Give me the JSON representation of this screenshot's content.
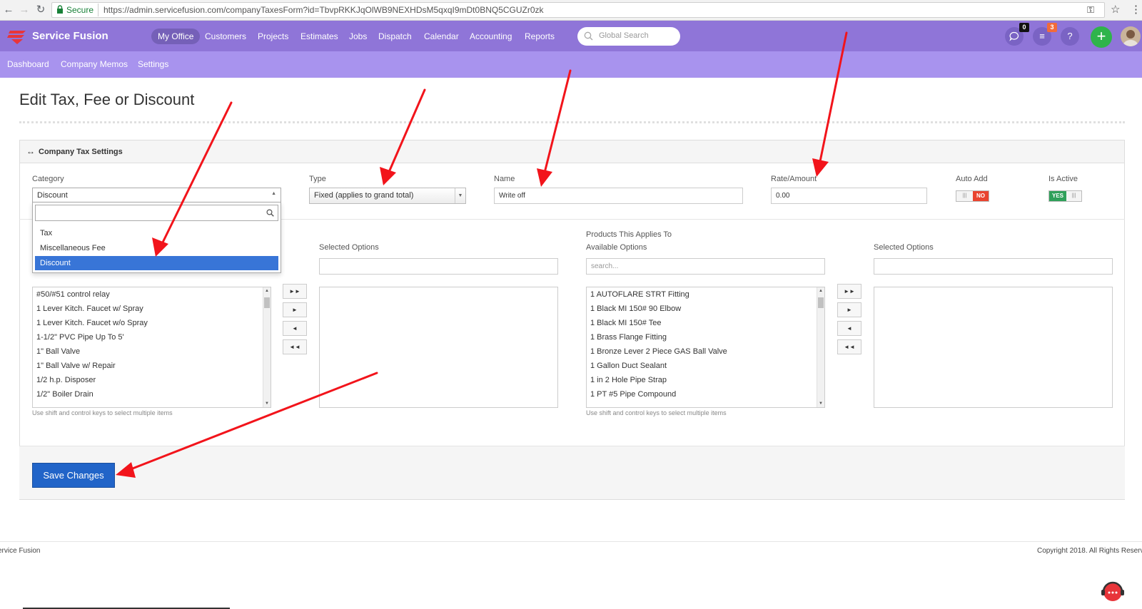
{
  "browser": {
    "secure_label": "Secure",
    "url": "https://admin.servicefusion.com/companyTaxesForm?id=TbvpRKKJqOlWB9NEXHDsM5qxqI9mDt0BNQ5CGUZr0zk"
  },
  "header": {
    "brand": "Service Fusion",
    "nav": [
      "My Office",
      "Customers",
      "Projects",
      "Estimates",
      "Jobs",
      "Dispatch",
      "Calendar",
      "Accounting",
      "Reports"
    ],
    "active_nav": "My Office",
    "search_placeholder": "Global Search",
    "chat_count": "0",
    "tasks_count": "3",
    "help_label": "?",
    "add_label": "+",
    "brand_color": "#8f75d8"
  },
  "subnav": [
    "Dashboard",
    "Company Memos",
    "Settings"
  ],
  "page": {
    "title": "Edit Tax, Fee or Discount",
    "panel_title": "Company Tax Settings"
  },
  "form": {
    "category_label": "Category",
    "category_value": "Discount",
    "category_options": [
      "Tax",
      "Miscellaneous Fee",
      "Discount"
    ],
    "category_selected": "Discount",
    "type_label": "Type",
    "type_value": "Fixed (applies to grand total)",
    "name_label": "Name",
    "name_value": "Write off",
    "rate_label": "Rate/Amount",
    "rate_value": "0.00",
    "auto_add_label": "Auto Add",
    "auto_add_state": "NO",
    "is_active_label": "Is Active",
    "is_active_state": "YES"
  },
  "services": {
    "selected_label": "Selected Options",
    "items": [
      "#50/#51 control relay",
      "1 Lever Kitch. Faucet w/ Spray",
      "1 Lever Kitch. Faucet w/o Spray",
      "1-1/2\" PVC Pipe Up To 5'",
      "1\" Ball Valve",
      "1\" Ball Valve w/ Repair",
      "1/2 h.p. Disposer",
      "1/2\" Boiler Drain"
    ],
    "hint": "Use shift and control keys to select multiple items"
  },
  "products": {
    "section_label": "Products This Applies To",
    "available_label": "Available Options",
    "selected_label": "Selected Options",
    "search_placeholder": "search...",
    "items": [
      "1 AUTOFLARE STRT Fitting",
      "1 Black MI 150# 90 Elbow",
      "1 Black MI 150# Tee",
      "1 Brass Flange Fitting",
      "1 Bronze Lever 2 Piece GAS Ball Valve",
      "1 Gallon Duct Sealant",
      "1 in 2 Hole Pipe Strap",
      "1 PT #5 Pipe Compound"
    ],
    "hint": "Use shift and control keys to select multiple items"
  },
  "actions": {
    "save_label": "Save Changes"
  },
  "footer": {
    "left": "ervice Fusion",
    "right": "Copyright 2018. All Rights Reserve"
  }
}
